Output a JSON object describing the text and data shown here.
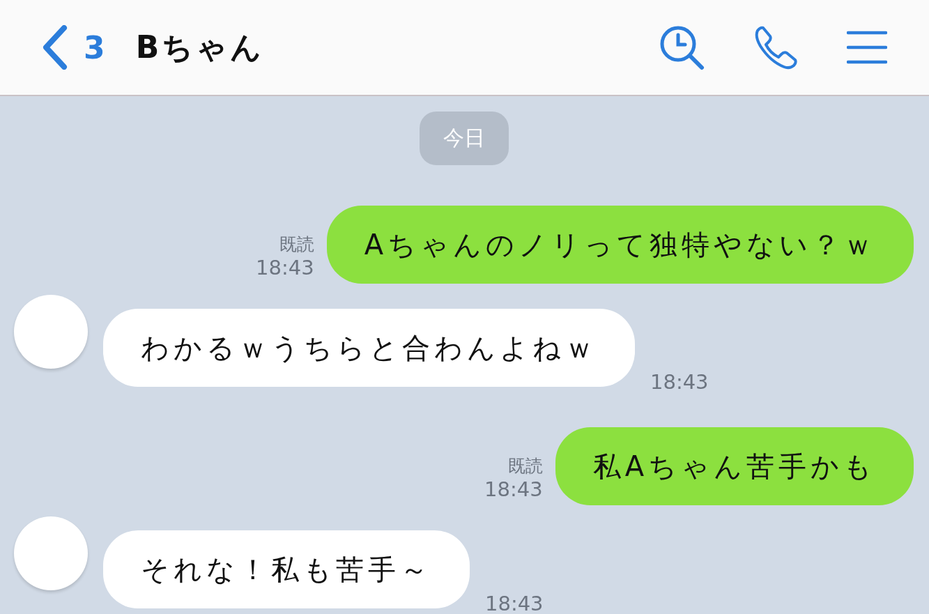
{
  "header": {
    "back_count": "3",
    "title": "Bちゃん"
  },
  "date_label": "今日",
  "messages": [
    {
      "kind": "sent",
      "text": "Aちゃんのノリって独特やない？ｗ",
      "read_label": "既読",
      "time": "18:43"
    },
    {
      "kind": "received",
      "text": "わかるｗうちらと合わんよねｗ",
      "time": "18:43"
    },
    {
      "kind": "sent",
      "text": "私Aちゃん苦手かも",
      "read_label": "既読",
      "time": "18:43"
    },
    {
      "kind": "received",
      "text": "それな！私も苦手～",
      "time": "18:43"
    }
  ]
}
